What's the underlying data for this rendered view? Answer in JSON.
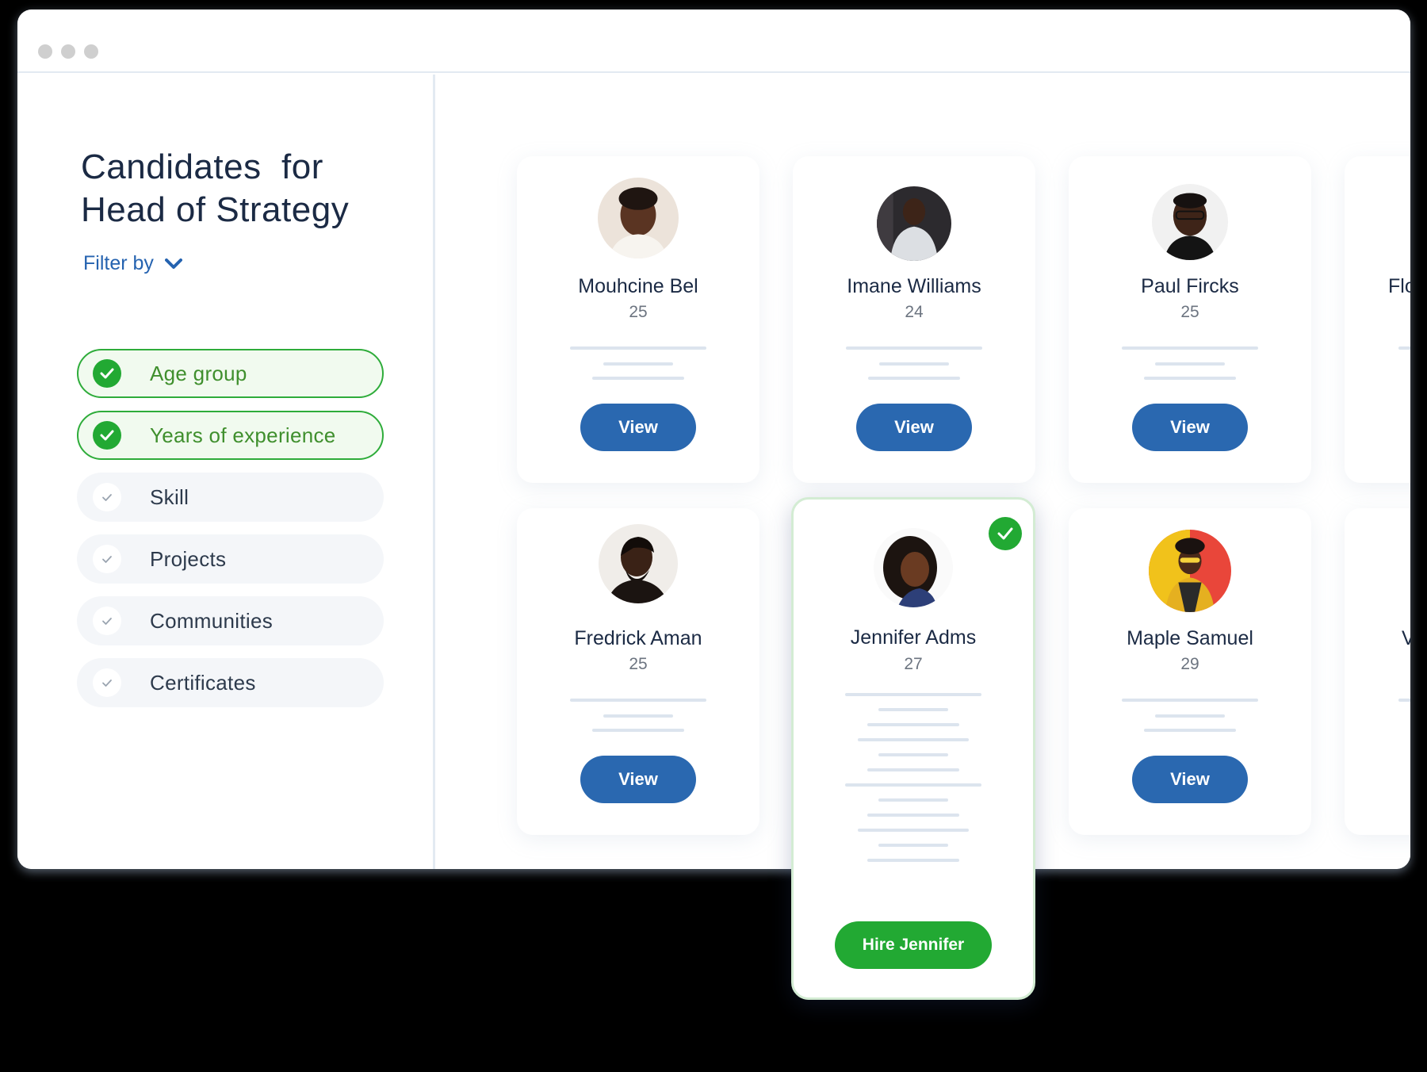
{
  "sidebar": {
    "title_line1": "Candidates  for",
    "title_line2": "Head of Strategy",
    "filter_label": "Filter by",
    "filters": [
      {
        "label": "Age group",
        "active": true
      },
      {
        "label": "Years of experience",
        "active": true
      },
      {
        "label": "Skill",
        "active": false
      },
      {
        "label": "Projects",
        "active": false
      },
      {
        "label": "Communities",
        "active": false
      },
      {
        "label": "Certificates",
        "active": false
      }
    ]
  },
  "candidates": [
    {
      "name": "Mouhcine Bel",
      "age": "25",
      "button": "View"
    },
    {
      "name": "Imane Williams",
      "age": "24",
      "button": "View"
    },
    {
      "name": "Paul Fircks",
      "age": "25",
      "button": "View"
    },
    {
      "name": "Fredrick Aman",
      "age": "25",
      "button": "View"
    },
    {
      "name": "Jennifer Adms",
      "age": "27",
      "button": "Hire Jennifer",
      "selected": true
    },
    {
      "name": "Maple Samuel",
      "age": "29",
      "button": "View"
    }
  ],
  "partial_cards": [
    {
      "name_fragment": "Flo"
    },
    {
      "name_fragment": "V"
    }
  ],
  "colors": {
    "primary_blue": "#2a68b0",
    "success_green": "#22a933",
    "title_navy": "#1b2a44"
  },
  "icons": [
    "window-dot-icon",
    "chevron-down-icon",
    "check-icon",
    "avatar-photo"
  ]
}
